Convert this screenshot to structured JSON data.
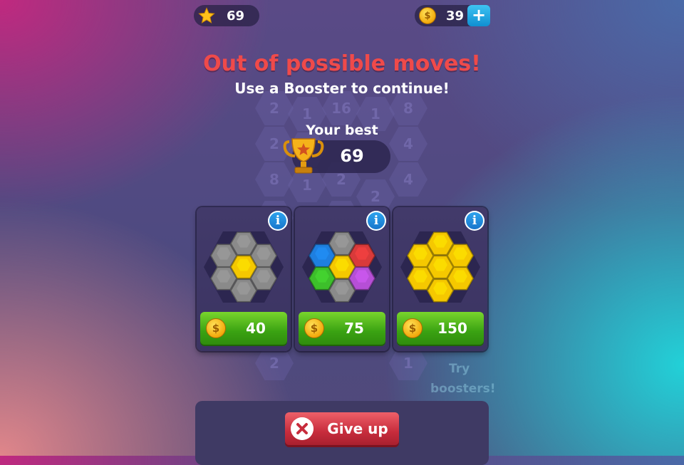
{
  "hud": {
    "stars": {
      "icon": "star-icon",
      "value": "69"
    },
    "coins": {
      "icon": "coin-icon",
      "value": "39",
      "add_icon": "plus-icon"
    }
  },
  "dialog": {
    "title": "Out of possible moves!",
    "subtitle": "Use a Booster to continue!",
    "best_label": "Your best",
    "best_value": "69"
  },
  "board_numbers": [
    "2",
    "1",
    "16",
    "1",
    "8",
    "2",
    "1",
    "4",
    "8",
    "2",
    "4",
    "1",
    "2",
    "2",
    "4",
    "2",
    "1"
  ],
  "boosters": [
    {
      "name": "gray-hex-booster",
      "price": "40",
      "colors": [
        "#8a8a8a",
        "#8a8a8a",
        "#8a8a8a",
        "#f5c800",
        "#8a8a8a",
        "#8a8a8a",
        "#8a8a8a"
      ]
    },
    {
      "name": "color-hex-booster",
      "price": "75",
      "colors": [
        "#8a8a8a",
        "#1e7fe0",
        "#d93a3a",
        "#f5c800",
        "#3dbf2b",
        "#b64fd6",
        "#8a8a8a"
      ]
    },
    {
      "name": "gold-hex-booster",
      "price": "150",
      "colors": [
        "#f5c800",
        "#f5c800",
        "#f5c800",
        "#f5c800",
        "#f5c800",
        "#f5c800",
        "#f5c800"
      ]
    }
  ],
  "hint": {
    "line1": "Try",
    "line2": "boosters!"
  },
  "give_up": {
    "label": "Give up",
    "icon": "close-icon"
  },
  "colors": {
    "title": "#ef4a4a",
    "buy_green": "#3aa212",
    "give_up_red": "#c72c3c",
    "info_blue": "#1e8ae0"
  }
}
